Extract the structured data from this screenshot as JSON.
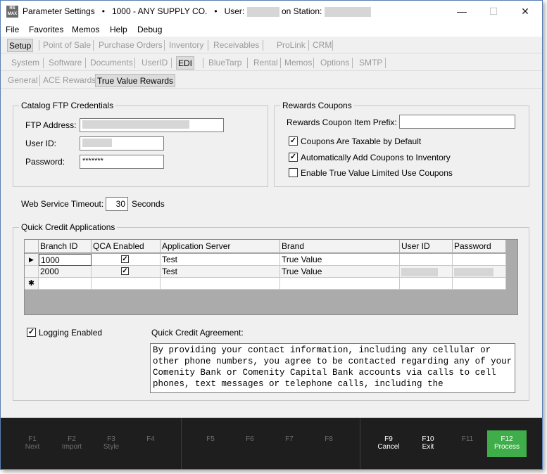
{
  "window": {
    "logo_text": "RS MAX",
    "title_prefix": "Parameter Settings",
    "bullet": "•",
    "company": "1000 - ANY SUPPLY CO.",
    "user_label": "User:",
    "station_label": "on Station:",
    "minimize": "—",
    "maximize": "☐",
    "close": "✕"
  },
  "menu": [
    "File",
    "Favorites",
    "Memos",
    "Help",
    "Debug"
  ],
  "main_tabs": [
    "Setup",
    "Point of Sale",
    "Purchase Orders",
    "Inventory",
    "Receivables",
    "ProLink",
    "CRM"
  ],
  "sub_tabs": [
    "System",
    "Software",
    "Documents",
    "UserID",
    "EDI",
    "BlueTarp",
    "Rental",
    "Memos",
    "Options",
    "SMTP"
  ],
  "edi_tabs": [
    "General",
    "ACE Rewards",
    "True Value Rewards"
  ],
  "ftp": {
    "title": "Catalog FTP Credentials",
    "address_label": "FTP Address:",
    "userid_label": "User ID:",
    "password_label": "Password:",
    "password_value": "*******"
  },
  "coupons": {
    "title": "Rewards Coupons",
    "prefix_label": "Rewards Coupon Item Prefix:",
    "prefix_value": "",
    "taxable_label": "Coupons Are Taxable by Default",
    "taxable_checked": true,
    "auto_add_label": "Automatically Add Coupons to Inventory",
    "auto_add_checked": true,
    "limited_label": "Enable True Value Limited Use Coupons",
    "limited_checked": false
  },
  "timeout": {
    "label": "Web Service Timeout:",
    "value": "30",
    "unit": "Seconds"
  },
  "qca": {
    "title": "Quick Credit Applications",
    "columns": [
      "Branch ID",
      "QCA Enabled",
      "Application Server",
      "Brand",
      "User ID",
      "Password"
    ],
    "rows": [
      {
        "branch": "1000",
        "enabled": "✓",
        "server": "Test",
        "brand": "True Value"
      },
      {
        "branch": "2000",
        "enabled": "✓",
        "server": "Test",
        "brand": "True Value"
      }
    ],
    "current_row_marker": "▶",
    "new_row_marker": "✱",
    "logging_label": "Logging Enabled",
    "logging_checked": true,
    "agreement_label": "Quick Credit Agreement:",
    "agreement_text": "By providing your contact information, including any cellular or other phone numbers, you agree to be contacted regarding any of your Comenity Bank or Comenity Capital Bank accounts via calls to cell phones, text messages or telephone calls, including the"
  },
  "fkeys": [
    {
      "key": "F1",
      "label": "Next"
    },
    {
      "key": "F2",
      "label": "Import"
    },
    {
      "key": "F3",
      "label": "Style"
    },
    {
      "key": "F4",
      "label": ""
    },
    {
      "key": "F5",
      "label": ""
    },
    {
      "key": "F6",
      "label": ""
    },
    {
      "key": "F7",
      "label": ""
    },
    {
      "key": "F8",
      "label": ""
    },
    {
      "key": "F9",
      "label": "Cancel"
    },
    {
      "key": "F10",
      "label": "Exit"
    },
    {
      "key": "F11",
      "label": ""
    },
    {
      "key": "F12",
      "label": "Process"
    }
  ],
  "colors": {
    "footer_bg": "#1e1e1e",
    "process_button": "#3fae4a",
    "window_border": "#5a7fb5"
  }
}
